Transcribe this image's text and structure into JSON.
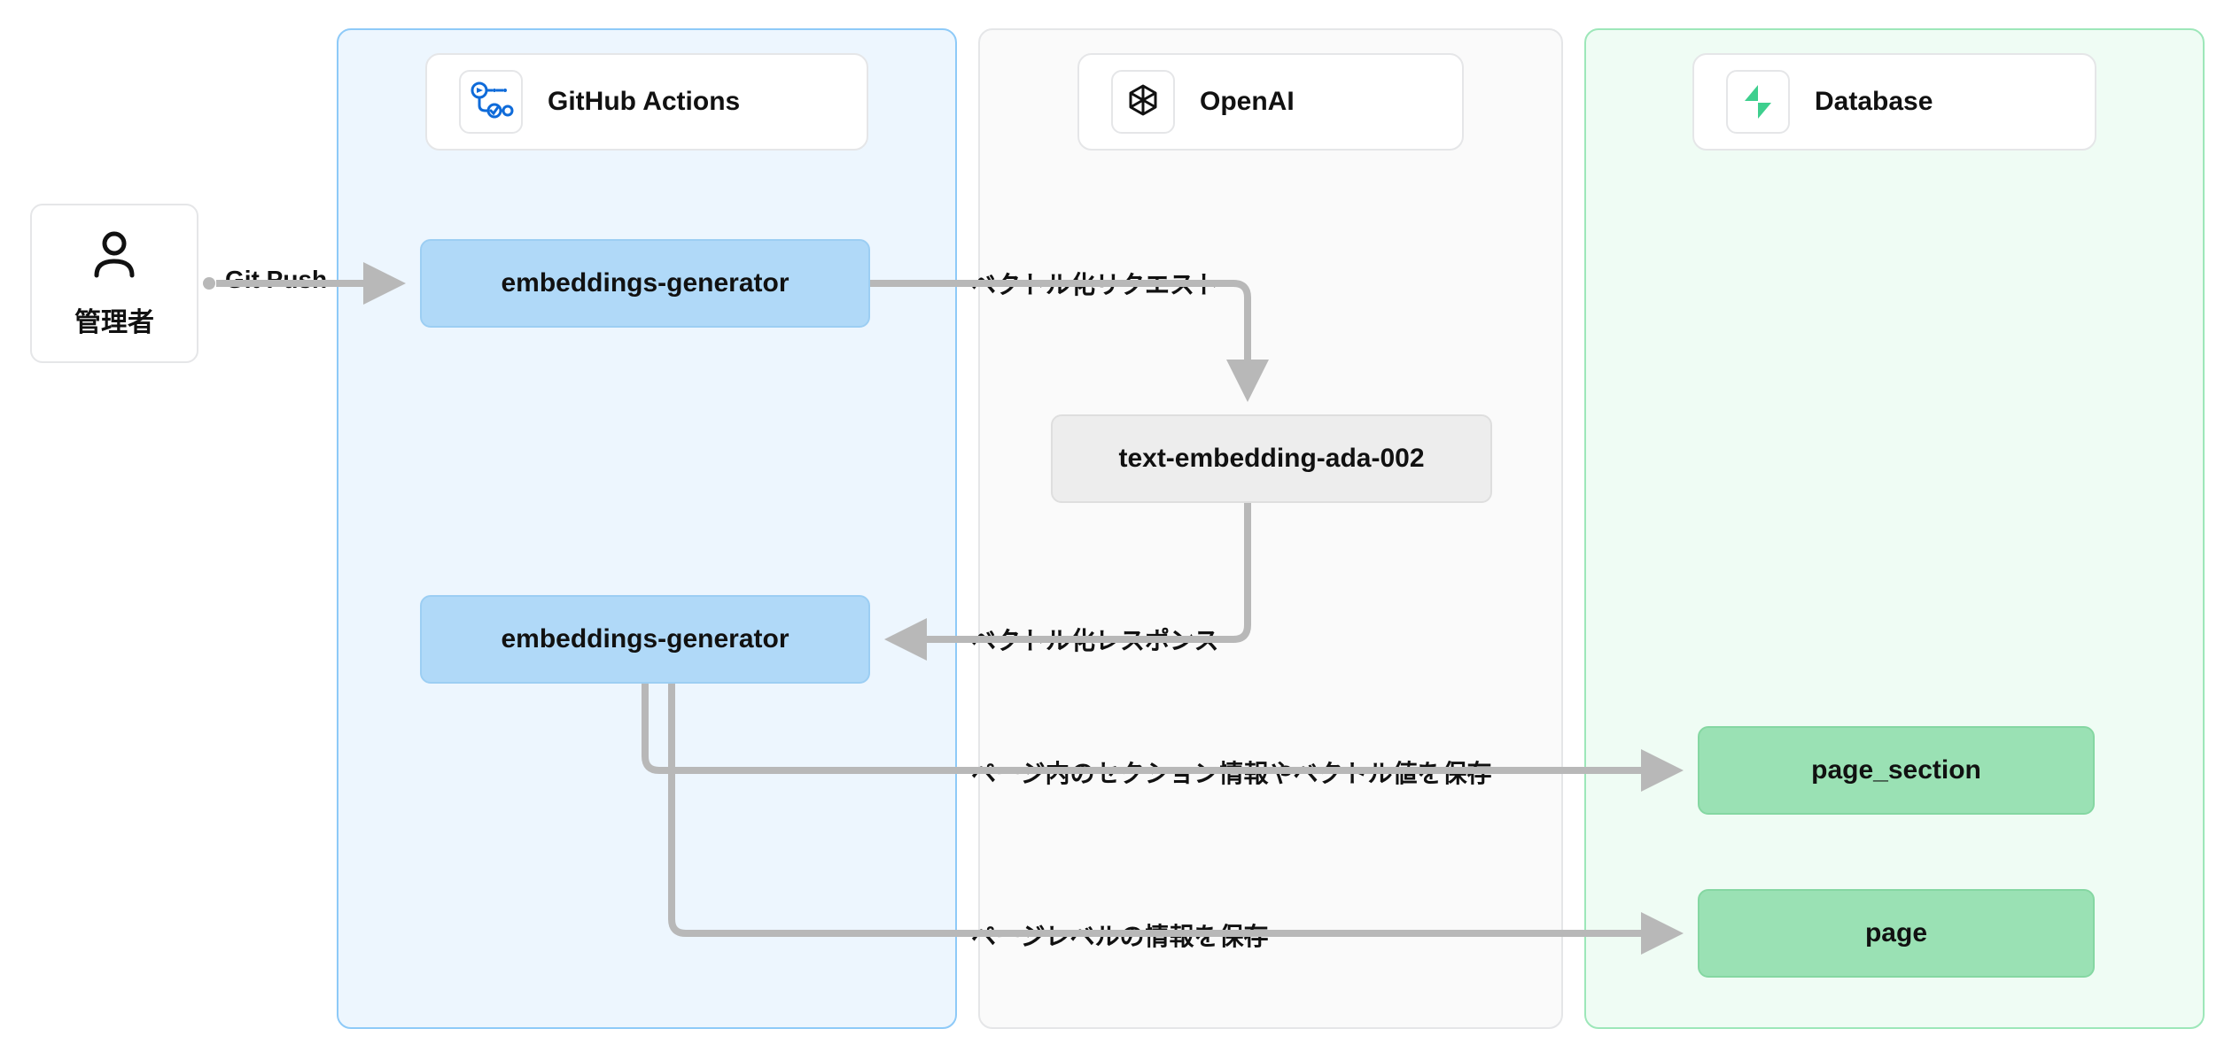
{
  "actor": {
    "label": "管理者"
  },
  "lanes": {
    "gha": {
      "title": "GitHub Actions"
    },
    "openai": {
      "title": "OpenAI"
    },
    "db": {
      "title": "Database"
    }
  },
  "nodes": {
    "gen1": {
      "label": "embeddings-generator"
    },
    "gen2": {
      "label": "embeddings-generator"
    },
    "model": {
      "label": "text-embedding-ada-002"
    },
    "ps": {
      "label": "page_section"
    },
    "page": {
      "label": "page"
    }
  },
  "edges": {
    "push": {
      "label": "Git Push"
    },
    "vec_request": {
      "label": "ベクトル化リクエスト"
    },
    "vec_response": {
      "label": "ベクトル化レスポンス"
    },
    "save_sections": {
      "label": "ページ内のセクション情報やベクトル値を保存"
    },
    "save_page": {
      "label": "ページレベルの情報を保存"
    }
  }
}
